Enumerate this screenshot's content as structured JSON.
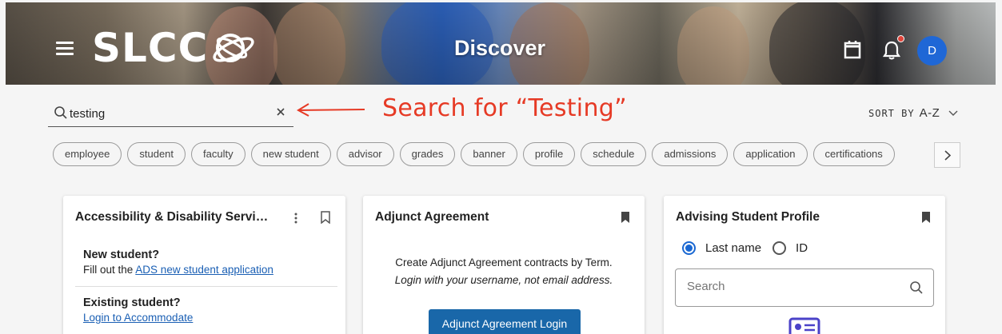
{
  "header": {
    "logo_text": "SLCC",
    "title": "Discover",
    "avatar_initial": "D",
    "icons": [
      "menu-icon",
      "calendar-icon",
      "bell-icon",
      "avatar"
    ]
  },
  "search": {
    "value": "testing",
    "annotation": "Search for “Testing”"
  },
  "sort": {
    "label": "SORT BY",
    "value": "A-Z"
  },
  "chips": [
    "employee",
    "student",
    "faculty",
    "new student",
    "advisor",
    "grades",
    "banner",
    "profile",
    "schedule",
    "admissions",
    "application",
    "certifications"
  ],
  "cards": {
    "ads": {
      "title": "Accessibility & Disability Servi…",
      "new_heading": "New student?",
      "new_text": "Fill out the ",
      "new_link": "ADS new student application",
      "existing_heading": "Existing student?",
      "existing_link": "Login to Accommodate"
    },
    "adjunct": {
      "title": "Adjunct Agreement",
      "desc_line1": "Create Adjunct Agreement contracts by Term.",
      "desc_line2": "Login with your username, not email address.",
      "button": "Adjunct Agreement Login"
    },
    "advising": {
      "title": "Advising Student Profile",
      "radio1": "Last name",
      "radio2": "ID",
      "selected": "Last name",
      "search_placeholder": "Search"
    }
  },
  "colors": {
    "accent": "#1967d2",
    "annotation": "#e63a25",
    "button": "#1967a9",
    "link": "#1a5fb4"
  }
}
